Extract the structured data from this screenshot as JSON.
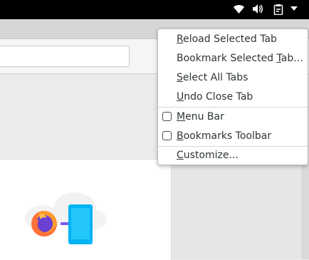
{
  "menu": {
    "items": [
      {
        "pre": "",
        "ul": "R",
        "post": "eload Selected Tab"
      },
      {
        "pre": "Bookmark Selected ",
        "ul": "T",
        "post": "ab…"
      },
      {
        "pre": "",
        "ul": "S",
        "post": "elect All Tabs"
      },
      {
        "pre": "",
        "ul": "U",
        "post": "ndo Close Tab"
      }
    ],
    "checks": [
      {
        "pre": "",
        "ul": "M",
        "post": "enu Bar",
        "checked": false
      },
      {
        "pre": "",
        "ul": "B",
        "post": "ookmarks Toolbar",
        "checked": false
      }
    ],
    "customize": {
      "pre": "",
      "ul": "C",
      "post": "ustomize..."
    }
  },
  "tray": {
    "icons": [
      "wifi-icon",
      "volume-icon",
      "clipboard-icon",
      "dropdown-arrow-icon"
    ]
  },
  "colors": {
    "panel": "#000000",
    "firefox_orange": "#ff7139",
    "device_blue": "#00b3f4"
  }
}
